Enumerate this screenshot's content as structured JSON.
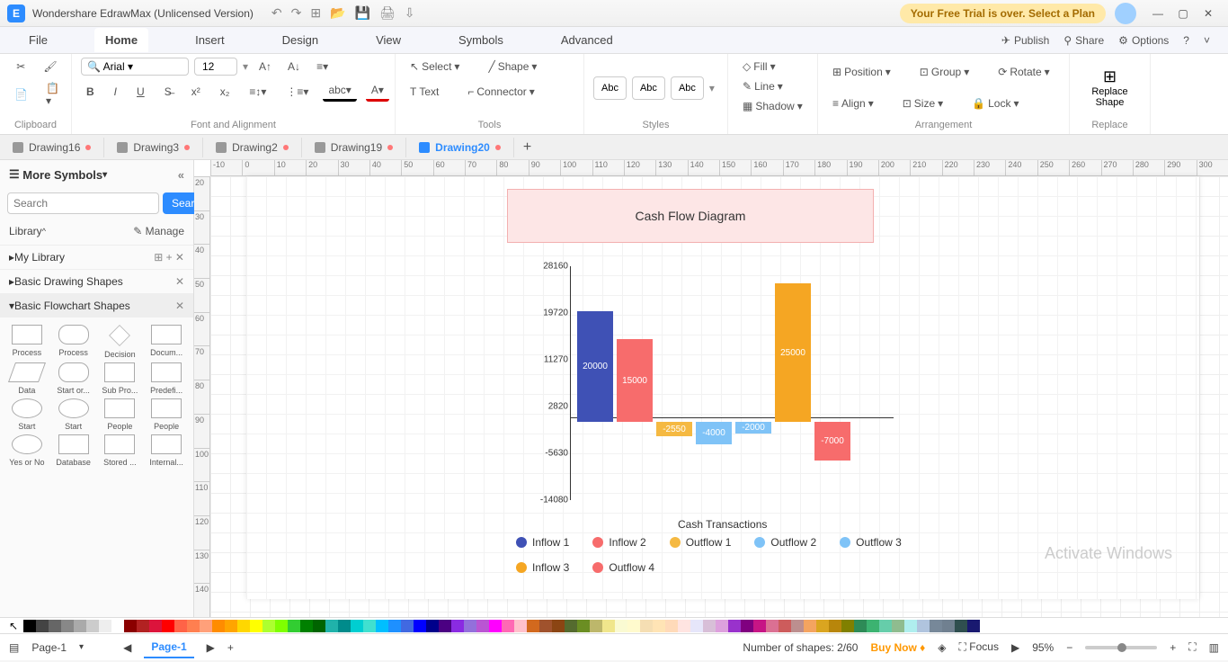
{
  "app": {
    "title": "Wondershare EdrawMax (Unlicensed Version)",
    "trial_banner": "Your Free Trial is over. Select a Plan"
  },
  "menu": {
    "items": [
      "File",
      "Home",
      "Insert",
      "Design",
      "View",
      "Symbols",
      "Advanced"
    ],
    "active": "Home",
    "right": {
      "publish": "Publish",
      "share": "Share",
      "options": "Options"
    }
  },
  "ribbon": {
    "clipboard": "Clipboard",
    "font_alignment": "Font and Alignment",
    "font_name": "Arial",
    "font_size": "12",
    "tools": "Tools",
    "select": "Select",
    "shape": "Shape",
    "text": "Text",
    "connector": "Connector",
    "styles": "Styles",
    "abc": "Abc",
    "fill": "Fill",
    "line": "Line",
    "shadow": "Shadow",
    "arrangement": "Arrangement",
    "position": "Position",
    "align": "Align",
    "group": "Group",
    "size": "Size",
    "rotate": "Rotate",
    "lock": "Lock",
    "replace": "Replace",
    "replace_shape": "Replace Shape"
  },
  "tabs": [
    "Drawing16",
    "Drawing3",
    "Drawing2",
    "Drawing19",
    "Drawing20"
  ],
  "active_tab": "Drawing20",
  "sidebar": {
    "title": "More Symbols",
    "search_placeholder": "Search",
    "search_btn": "Search",
    "library": "Library",
    "manage": "Manage",
    "my_library": "My Library",
    "basic_drawing": "Basic Drawing Shapes",
    "basic_flowchart": "Basic Flowchart Shapes",
    "shapes": [
      "Process",
      "Process",
      "Decision",
      "Docum...",
      "Data",
      "Start or...",
      "Sub Pro...",
      "Predefi...",
      "Start",
      "Start",
      "People",
      "People",
      "Yes or No",
      "Database",
      "Stored ...",
      "Internal..."
    ]
  },
  "ruler_h": [
    "-10",
    "0",
    "10",
    "20",
    "30",
    "40",
    "50",
    "60",
    "70",
    "80",
    "90",
    "100",
    "110",
    "120",
    "130",
    "140",
    "150",
    "160",
    "170",
    "180",
    "190",
    "200",
    "210",
    "220",
    "230",
    "240",
    "250",
    "260",
    "270",
    "280",
    "290",
    "300"
  ],
  "ruler_v": [
    "20",
    "30",
    "40",
    "50",
    "60",
    "70",
    "80",
    "90",
    "100",
    "110",
    "120",
    "130",
    "140"
  ],
  "chart_data": {
    "type": "bar",
    "title": "Cash Flow Diagram",
    "subtitle": "Cash Transactions",
    "ylabels": [
      "28160",
      "19720",
      "11270",
      "2820",
      "-5630",
      "-14080"
    ],
    "ylim": [
      -14080,
      28160
    ],
    "series": [
      {
        "name": "Inflow 1",
        "value": 20000,
        "color": "#3f51b5"
      },
      {
        "name": "Inflow 2",
        "value": 15000,
        "color": "#f76c6c"
      },
      {
        "name": "Outflow 1",
        "value": -2550,
        "color": "#f5b942"
      },
      {
        "name": "Outflow 2",
        "value": -4000,
        "color": "#7fc3f7"
      },
      {
        "name": "Outflow 3",
        "value": -2000,
        "color": "#7fc3f7"
      },
      {
        "name": "Inflow 3",
        "value": 25000,
        "color": "#f5a623"
      },
      {
        "name": "Outflow 4",
        "value": -7000,
        "color": "#f76c6c"
      }
    ]
  },
  "status": {
    "page_sel": "Page-1",
    "active_page": "Page-1",
    "shapes_count": "Number of shapes: 2/60",
    "buy_now": "Buy Now",
    "focus": "Focus",
    "zoom": "95%"
  },
  "watermark": "Activate Windows",
  "palette": [
    "#000",
    "#444",
    "#666",
    "#888",
    "#aaa",
    "#ccc",
    "#eee",
    "#fff",
    "#8b0000",
    "#b22222",
    "#dc143c",
    "#ff0000",
    "#ff6347",
    "#ff7f50",
    "#ffa07a",
    "#ff8c00",
    "#ffa500",
    "#ffd700",
    "#ffff00",
    "#adff2f",
    "#7fff00",
    "#32cd32",
    "#008000",
    "#006400",
    "#20b2aa",
    "#008b8b",
    "#00ced1",
    "#40e0d0",
    "#00bfff",
    "#1e90ff",
    "#4169e1",
    "#0000ff",
    "#00008b",
    "#4b0082",
    "#8a2be2",
    "#9370db",
    "#ba55d3",
    "#ff00ff",
    "#ff69b4",
    "#ffc0cb",
    "#d2691e",
    "#a0522d",
    "#8b4513",
    "#556b2f",
    "#6b8e23",
    "#bdb76b",
    "#f0e68c",
    "#fafad2",
    "#fffacd",
    "#f5deb3",
    "#ffe4b5",
    "#ffdab9",
    "#ffe4e1",
    "#e6e6fa",
    "#d8bfd8",
    "#dda0dd",
    "#9932cc",
    "#800080",
    "#c71585",
    "#db7093",
    "#cd5c5c",
    "#bc8f8f",
    "#f4a460",
    "#daa520",
    "#b8860b",
    "#808000",
    "#2e8b57",
    "#3cb371",
    "#66cdaa",
    "#8fbc8f",
    "#afeeee",
    "#b0c4de",
    "#778899",
    "#708090",
    "#2f4f4f",
    "#191970"
  ]
}
